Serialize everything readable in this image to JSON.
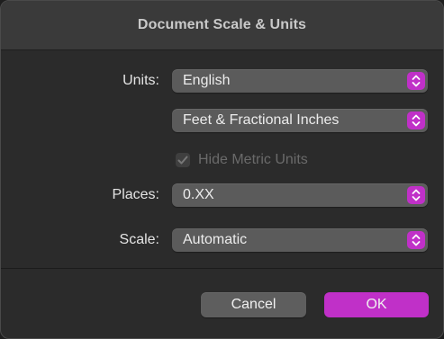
{
  "window": {
    "title": "Document Scale & Units"
  },
  "units": {
    "label": "Units:",
    "value": "English"
  },
  "format": {
    "value": "Feet & Fractional Inches"
  },
  "hide_metric": {
    "label": "Hide Metric Units",
    "checked": true,
    "enabled": false
  },
  "places": {
    "label": "Places:",
    "value": "0.XX"
  },
  "scale": {
    "label": "Scale:",
    "value": "Automatic"
  },
  "buttons": {
    "cancel": "Cancel",
    "ok": "OK"
  },
  "colors": {
    "accent": "#c030c8",
    "dialog_bg": "#2b2b2b",
    "control_bg": "#5b5b5b"
  },
  "icons": {
    "stepper": "chevron-up-down-icon",
    "check": "checkmark-icon"
  }
}
